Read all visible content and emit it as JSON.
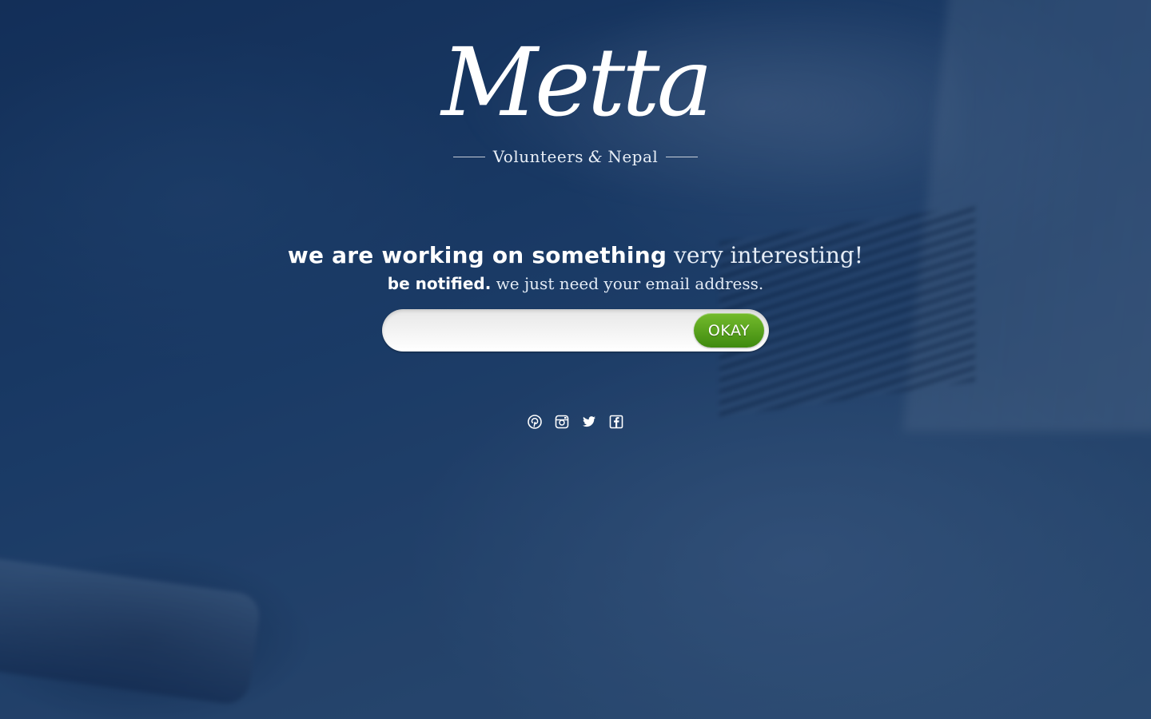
{
  "brand": {
    "logo_text": "Metta",
    "tagline_left": "Volunteers",
    "tagline_amp": "&",
    "tagline_right": "Nepal"
  },
  "headline": {
    "bold": "we are working on something",
    "light": "very interesting!"
  },
  "subline": {
    "bold": "be notified.",
    "light": "we just need your email address."
  },
  "signup": {
    "email_value": "",
    "email_placeholder": "",
    "button_label": "OKAY"
  },
  "social": [
    {
      "icon": "pinterest-icon"
    },
    {
      "icon": "instagram-icon"
    },
    {
      "icon": "twitter-icon"
    },
    {
      "icon": "facebook-icon"
    }
  ],
  "colors": {
    "background": "#1e3b62",
    "button_green": "#5aa21f",
    "text": "#ffffff"
  }
}
